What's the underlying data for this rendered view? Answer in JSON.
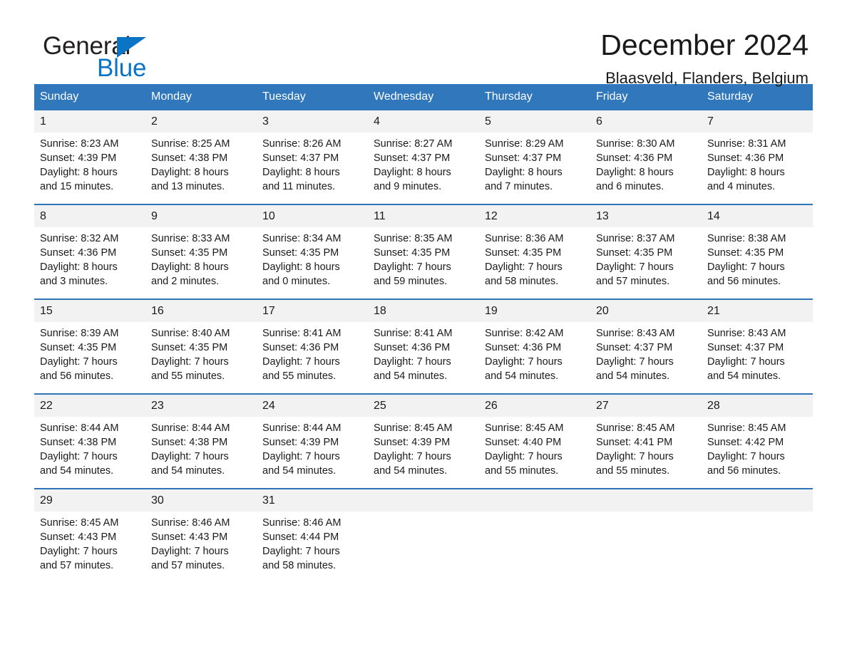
{
  "brand": {
    "name_part1": "General",
    "name_part2": "Blue",
    "triangle_icon": "triangle-icon",
    "accent_color": "#0b74c4"
  },
  "header": {
    "month_title": "December 2024",
    "location": "Blaasveld, Flanders, Belgium"
  },
  "calendar": {
    "header_bg": "#3077bb",
    "row_divider_color": "#2e75b6",
    "daynum_bg": "#f2f2f2",
    "weekdays": [
      "Sunday",
      "Monday",
      "Tuesday",
      "Wednesday",
      "Thursday",
      "Friday",
      "Saturday"
    ],
    "weeks": [
      [
        {
          "day": "1",
          "sunrise": "Sunrise: 8:23 AM",
          "sunset": "Sunset: 4:39 PM",
          "daylight_line1": "Daylight: 8 hours",
          "daylight_line2": "and 15 minutes."
        },
        {
          "day": "2",
          "sunrise": "Sunrise: 8:25 AM",
          "sunset": "Sunset: 4:38 PM",
          "daylight_line1": "Daylight: 8 hours",
          "daylight_line2": "and 13 minutes."
        },
        {
          "day": "3",
          "sunrise": "Sunrise: 8:26 AM",
          "sunset": "Sunset: 4:37 PM",
          "daylight_line1": "Daylight: 8 hours",
          "daylight_line2": "and 11 minutes."
        },
        {
          "day": "4",
          "sunrise": "Sunrise: 8:27 AM",
          "sunset": "Sunset: 4:37 PM",
          "daylight_line1": "Daylight: 8 hours",
          "daylight_line2": "and 9 minutes."
        },
        {
          "day": "5",
          "sunrise": "Sunrise: 8:29 AM",
          "sunset": "Sunset: 4:37 PM",
          "daylight_line1": "Daylight: 8 hours",
          "daylight_line2": "and 7 minutes."
        },
        {
          "day": "6",
          "sunrise": "Sunrise: 8:30 AM",
          "sunset": "Sunset: 4:36 PM",
          "daylight_line1": "Daylight: 8 hours",
          "daylight_line2": "and 6 minutes."
        },
        {
          "day": "7",
          "sunrise": "Sunrise: 8:31 AM",
          "sunset": "Sunset: 4:36 PM",
          "daylight_line1": "Daylight: 8 hours",
          "daylight_line2": "and 4 minutes."
        }
      ],
      [
        {
          "day": "8",
          "sunrise": "Sunrise: 8:32 AM",
          "sunset": "Sunset: 4:36 PM",
          "daylight_line1": "Daylight: 8 hours",
          "daylight_line2": "and 3 minutes."
        },
        {
          "day": "9",
          "sunrise": "Sunrise: 8:33 AM",
          "sunset": "Sunset: 4:35 PM",
          "daylight_line1": "Daylight: 8 hours",
          "daylight_line2": "and 2 minutes."
        },
        {
          "day": "10",
          "sunrise": "Sunrise: 8:34 AM",
          "sunset": "Sunset: 4:35 PM",
          "daylight_line1": "Daylight: 8 hours",
          "daylight_line2": "and 0 minutes."
        },
        {
          "day": "11",
          "sunrise": "Sunrise: 8:35 AM",
          "sunset": "Sunset: 4:35 PM",
          "daylight_line1": "Daylight: 7 hours",
          "daylight_line2": "and 59 minutes."
        },
        {
          "day": "12",
          "sunrise": "Sunrise: 8:36 AM",
          "sunset": "Sunset: 4:35 PM",
          "daylight_line1": "Daylight: 7 hours",
          "daylight_line2": "and 58 minutes."
        },
        {
          "day": "13",
          "sunrise": "Sunrise: 8:37 AM",
          "sunset": "Sunset: 4:35 PM",
          "daylight_line1": "Daylight: 7 hours",
          "daylight_line2": "and 57 minutes."
        },
        {
          "day": "14",
          "sunrise": "Sunrise: 8:38 AM",
          "sunset": "Sunset: 4:35 PM",
          "daylight_line1": "Daylight: 7 hours",
          "daylight_line2": "and 56 minutes."
        }
      ],
      [
        {
          "day": "15",
          "sunrise": "Sunrise: 8:39 AM",
          "sunset": "Sunset: 4:35 PM",
          "daylight_line1": "Daylight: 7 hours",
          "daylight_line2": "and 56 minutes."
        },
        {
          "day": "16",
          "sunrise": "Sunrise: 8:40 AM",
          "sunset": "Sunset: 4:35 PM",
          "daylight_line1": "Daylight: 7 hours",
          "daylight_line2": "and 55 minutes."
        },
        {
          "day": "17",
          "sunrise": "Sunrise: 8:41 AM",
          "sunset": "Sunset: 4:36 PM",
          "daylight_line1": "Daylight: 7 hours",
          "daylight_line2": "and 55 minutes."
        },
        {
          "day": "18",
          "sunrise": "Sunrise: 8:41 AM",
          "sunset": "Sunset: 4:36 PM",
          "daylight_line1": "Daylight: 7 hours",
          "daylight_line2": "and 54 minutes."
        },
        {
          "day": "19",
          "sunrise": "Sunrise: 8:42 AM",
          "sunset": "Sunset: 4:36 PM",
          "daylight_line1": "Daylight: 7 hours",
          "daylight_line2": "and 54 minutes."
        },
        {
          "day": "20",
          "sunrise": "Sunrise: 8:43 AM",
          "sunset": "Sunset: 4:37 PM",
          "daylight_line1": "Daylight: 7 hours",
          "daylight_line2": "and 54 minutes."
        },
        {
          "day": "21",
          "sunrise": "Sunrise: 8:43 AM",
          "sunset": "Sunset: 4:37 PM",
          "daylight_line1": "Daylight: 7 hours",
          "daylight_line2": "and 54 minutes."
        }
      ],
      [
        {
          "day": "22",
          "sunrise": "Sunrise: 8:44 AM",
          "sunset": "Sunset: 4:38 PM",
          "daylight_line1": "Daylight: 7 hours",
          "daylight_line2": "and 54 minutes."
        },
        {
          "day": "23",
          "sunrise": "Sunrise: 8:44 AM",
          "sunset": "Sunset: 4:38 PM",
          "daylight_line1": "Daylight: 7 hours",
          "daylight_line2": "and 54 minutes."
        },
        {
          "day": "24",
          "sunrise": "Sunrise: 8:44 AM",
          "sunset": "Sunset: 4:39 PM",
          "daylight_line1": "Daylight: 7 hours",
          "daylight_line2": "and 54 minutes."
        },
        {
          "day": "25",
          "sunrise": "Sunrise: 8:45 AM",
          "sunset": "Sunset: 4:39 PM",
          "daylight_line1": "Daylight: 7 hours",
          "daylight_line2": "and 54 minutes."
        },
        {
          "day": "26",
          "sunrise": "Sunrise: 8:45 AM",
          "sunset": "Sunset: 4:40 PM",
          "daylight_line1": "Daylight: 7 hours",
          "daylight_line2": "and 55 minutes."
        },
        {
          "day": "27",
          "sunrise": "Sunrise: 8:45 AM",
          "sunset": "Sunset: 4:41 PM",
          "daylight_line1": "Daylight: 7 hours",
          "daylight_line2": "and 55 minutes."
        },
        {
          "day": "28",
          "sunrise": "Sunrise: 8:45 AM",
          "sunset": "Sunset: 4:42 PM",
          "daylight_line1": "Daylight: 7 hours",
          "daylight_line2": "and 56 minutes."
        }
      ],
      [
        {
          "day": "29",
          "sunrise": "Sunrise: 8:45 AM",
          "sunset": "Sunset: 4:43 PM",
          "daylight_line1": "Daylight: 7 hours",
          "daylight_line2": "and 57 minutes."
        },
        {
          "day": "30",
          "sunrise": "Sunrise: 8:46 AM",
          "sunset": "Sunset: 4:43 PM",
          "daylight_line1": "Daylight: 7 hours",
          "daylight_line2": "and 57 minutes."
        },
        {
          "day": "31",
          "sunrise": "Sunrise: 8:46 AM",
          "sunset": "Sunset: 4:44 PM",
          "daylight_line1": "Daylight: 7 hours",
          "daylight_line2": "and 58 minutes."
        },
        {
          "day": "",
          "sunrise": "",
          "sunset": "",
          "daylight_line1": "",
          "daylight_line2": ""
        },
        {
          "day": "",
          "sunrise": "",
          "sunset": "",
          "daylight_line1": "",
          "daylight_line2": ""
        },
        {
          "day": "",
          "sunrise": "",
          "sunset": "",
          "daylight_line1": "",
          "daylight_line2": ""
        },
        {
          "day": "",
          "sunrise": "",
          "sunset": "",
          "daylight_line1": "",
          "daylight_line2": ""
        }
      ]
    ]
  }
}
